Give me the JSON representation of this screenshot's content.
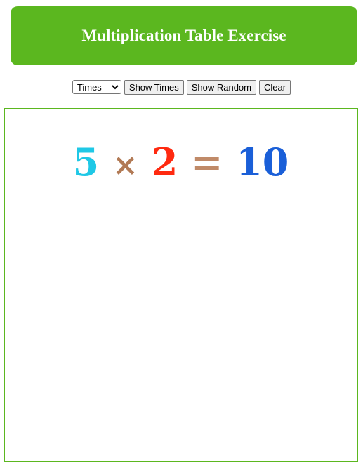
{
  "header": {
    "title": "Multiplication Table Exercise"
  },
  "toolbar": {
    "mode_select": {
      "selected": "Times"
    },
    "show_times_label": "Show Times",
    "show_random_label": "Show Random",
    "clear_label": "Clear"
  },
  "board": {
    "equation": {
      "left": "5",
      "operator": "×",
      "right": "2",
      "equals": "=",
      "result": "10"
    }
  },
  "colors": {
    "accent_green": "#5bb71f",
    "operand_left": "#1fc8e6",
    "operator": "#b27a55",
    "operand_right": "#ff2a10",
    "equals": "#c08a68",
    "result": "#1a5fd8"
  }
}
